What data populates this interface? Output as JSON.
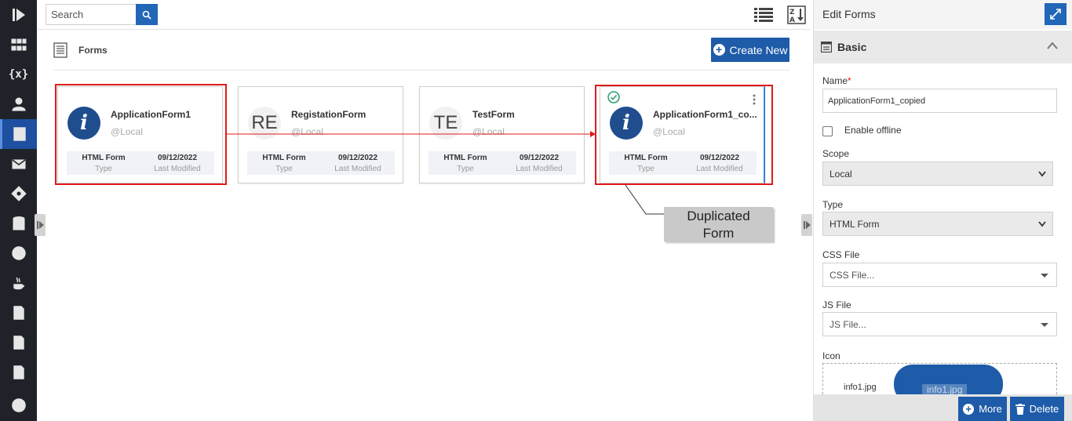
{
  "nav": {
    "items": [
      {
        "icon": "play-logo-icon"
      },
      {
        "icon": "workflow-icon"
      },
      {
        "icon": "variables-icon",
        "text": "{x}"
      },
      {
        "icon": "user-icon"
      },
      {
        "icon": "forms-icon",
        "active": true
      },
      {
        "icon": "mail-icon"
      },
      {
        "icon": "decision-icon"
      },
      {
        "icon": "database-icon"
      },
      {
        "icon": "decision-table-icon"
      },
      {
        "icon": "java-icon"
      },
      {
        "icon": "js-file-icon"
      },
      {
        "icon": "css-file-icon"
      },
      {
        "icon": "template-icon"
      },
      {
        "icon": "clock-icon"
      }
    ]
  },
  "toolbar": {
    "search_placeholder": "Search"
  },
  "header": {
    "title": "Forms",
    "create_label": "Create New"
  },
  "cards": [
    {
      "name": "ApplicationForm1",
      "scope": "@Local",
      "avatar": "i",
      "avatar_type": "info",
      "type": "HTML Form",
      "type_label": "Type",
      "modified": "09/12/2022",
      "modified_label": "Last Modified"
    },
    {
      "name": "RegistationForm",
      "scope": "@Local",
      "avatar": "RE",
      "avatar_type": "initials",
      "type": "HTML Form",
      "type_label": "Type",
      "modified": "09/12/2022",
      "modified_label": "Last Modified"
    },
    {
      "name": "TestForm",
      "scope": "@Local",
      "avatar": "TE",
      "avatar_type": "initials",
      "type": "HTML Form",
      "type_label": "Type",
      "modified": "09/12/2022",
      "modified_label": "Last Modified"
    },
    {
      "name": "ApplicationForm1_co...",
      "scope": "@Local",
      "avatar": "i",
      "avatar_type": "info",
      "type": "HTML Form",
      "type_label": "Type",
      "modified": "09/12/2022",
      "modified_label": "Last Modified",
      "selected": true
    }
  ],
  "annotation": {
    "callout_line1": "Duplicated",
    "callout_line2": "Form",
    "highlight_color": "#e11a1a"
  },
  "panel": {
    "title": "Edit Forms",
    "section_title": "Basic",
    "name_label": "Name",
    "name_required": "*",
    "name_value": "ApplicationForm1_copied",
    "offline_label": "Enable offline",
    "offline_checked": false,
    "scope_label": "Scope",
    "scope_value": "Local",
    "type_label": "Type",
    "type_value": "HTML Form",
    "css_label": "CSS File",
    "css_placeholder": "CSS File...",
    "js_label": "JS File",
    "js_placeholder": "JS File...",
    "icon_label": "Icon",
    "icon_file": "info1.jpg",
    "icon_preview_text": "info1.jpg",
    "more_label": "More",
    "delete_label": "Delete"
  },
  "colors": {
    "accent": "#1e5ba8",
    "nav_bg": "#1f2329",
    "nav_active": "#1e4fa0",
    "success": "#2a9d6f"
  }
}
